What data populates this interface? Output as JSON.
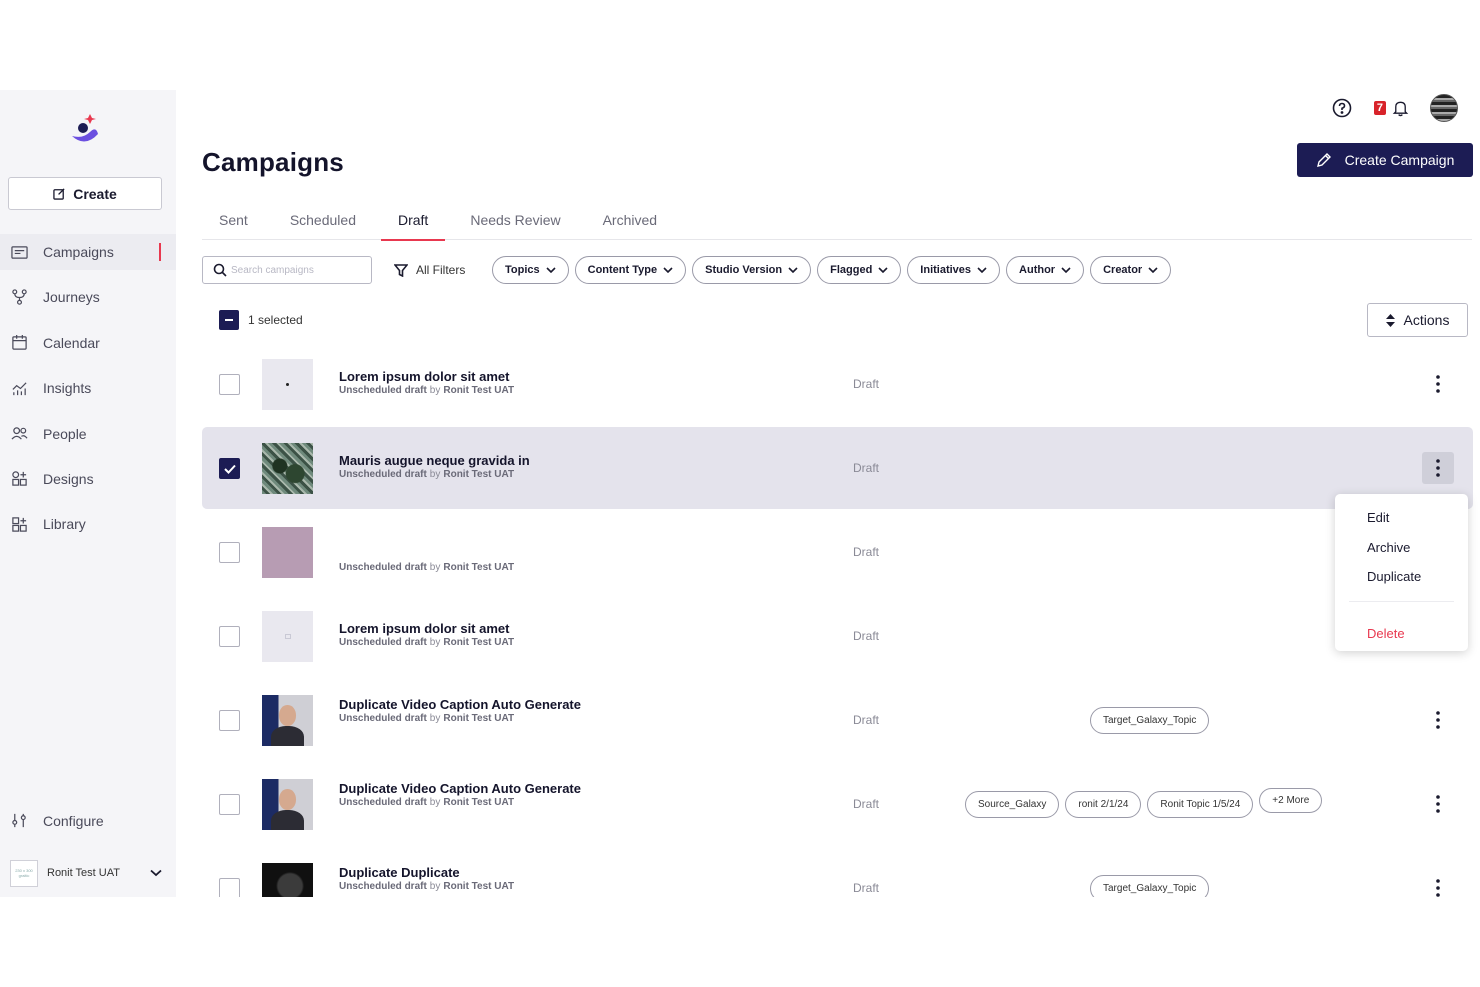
{
  "sidebar": {
    "create_label": "Create",
    "nav": [
      {
        "label": "Campaigns",
        "icon": "campaigns-icon",
        "active": true
      },
      {
        "label": "Journeys",
        "icon": "journeys-icon"
      },
      {
        "label": "Calendar",
        "icon": "calendar-icon"
      },
      {
        "label": "Insights",
        "icon": "insights-icon"
      },
      {
        "label": "People",
        "icon": "people-icon"
      },
      {
        "label": "Designs",
        "icon": "designs-icon"
      },
      {
        "label": "Library",
        "icon": "library-icon"
      }
    ],
    "configure_label": "Configure",
    "account_name": "Ronit Test UAT",
    "account_thumb_text": "230 x 300 graitic"
  },
  "header": {
    "title": "Campaigns",
    "create_campaign_label": "Create Campaign",
    "notification_count": "7"
  },
  "tabs": [
    {
      "label": "Sent"
    },
    {
      "label": "Scheduled"
    },
    {
      "label": "Draft",
      "active": true
    },
    {
      "label": "Needs Review"
    },
    {
      "label": "Archived"
    }
  ],
  "filters": {
    "search_placeholder": "Search campaigns",
    "all_filters_label": "All Filters",
    "chips": [
      "Topics",
      "Content Type",
      "Studio Version",
      "Flagged",
      "Initiatives",
      "Author",
      "Creator"
    ]
  },
  "selection": {
    "text": "1 selected",
    "actions_label": "Actions"
  },
  "rows": [
    {
      "title": "Lorem ipsum dolor sit amet",
      "status_line": "Unscheduled draft",
      "by": "by",
      "author": "Ronit Test UAT",
      "status": "Draft",
      "tags": []
    },
    {
      "title": "Mauris augue neque gravida in",
      "status_line": "Unscheduled draft",
      "by": "by",
      "author": "Ronit Test UAT",
      "status": "Draft",
      "tags": []
    },
    {
      "title": "",
      "status_line": "Unscheduled draft",
      "by": "by",
      "author": "Ronit Test UAT",
      "status": "Draft",
      "tags": []
    },
    {
      "title": "Lorem ipsum dolor sit amet",
      "status_line": "Unscheduled draft",
      "by": "by",
      "author": "Ronit Test UAT",
      "status": "Draft",
      "tags": []
    },
    {
      "title": "Duplicate Video Caption Auto Generate",
      "status_line": "Unscheduled draft",
      "by": "by",
      "author": "Ronit Test UAT",
      "status": "Draft",
      "tags": [
        "Target_Galaxy_Topic"
      ]
    },
    {
      "title": "Duplicate Video Caption Auto Generate",
      "status_line": "Unscheduled draft",
      "by": "by",
      "author": "Ronit Test UAT",
      "status": "Draft",
      "tags": [
        "Source_Galaxy",
        "ronit 2/1/24",
        "Ronit Topic 1/5/24",
        "+2 More"
      ]
    },
    {
      "title": "Duplicate Duplicate",
      "status_line": "Unscheduled draft",
      "by": "by",
      "author": "Ronit Test UAT",
      "status": "Draft",
      "tags": [
        "Target_Galaxy_Topic"
      ]
    }
  ],
  "menu": {
    "items": [
      "Edit",
      "Archive",
      "Duplicate"
    ],
    "danger_item": "Delete"
  },
  "colors": {
    "primary": "#1c1c54",
    "accent": "#e8384f",
    "selected_row": "#e4e3ec"
  }
}
